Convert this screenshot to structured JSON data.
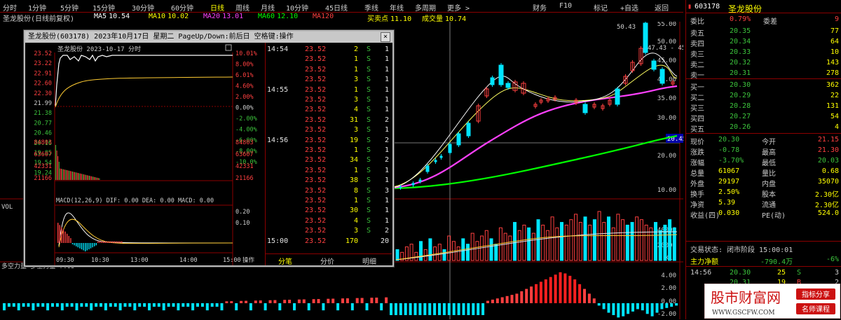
{
  "topbar": {
    "items": [
      "分时",
      "1分钟",
      "5分钟",
      "15分钟",
      "30分钟",
      "60分钟",
      "日线",
      "周线",
      "月线",
      "10分钟",
      "45日线",
      "季线",
      "年线",
      "多周期",
      "更多 >"
    ],
    "right_items": [
      "财务",
      "F10",
      "标记",
      "+自选",
      "返回"
    ]
  },
  "ma_row": {
    "stock_label": "圣龙股份(日线前复权)",
    "ma_items": [
      {
        "label": "MA5",
        "value": "10.54",
        "color": "#ffffff"
      },
      {
        "label": "MA10",
        "value": "10.02",
        "color": "#ffff00"
      },
      {
        "label": "MA20",
        "value": "13.01",
        "color": "#ff40ff"
      },
      {
        "label": "MA60",
        "value": "12.10",
        "color": "#00ff00"
      },
      {
        "label": "MA120",
        "value": "",
        "color": "#ff4040"
      },
      {
        "label": "买卖点",
        "value": "11.10",
        "color": "#ffff00"
      },
      {
        "label": "成交量",
        "value": "10.74",
        "color": "#ffff00"
      }
    ]
  },
  "main_chart": {
    "price_ticks": [
      "55.00",
      "50.00",
      "45.00",
      "40.00",
      "35.00",
      "30.00",
      "20.00",
      "10.00"
    ],
    "highlight_price": "20.45",
    "high_label": "50.43",
    "range_label": "47.43 - 45",
    "volume_label": "VOL",
    "vol_ticks": [
      "40000",
      "20000",
      "X10"
    ],
    "macd_label": "多空力量 多空力量 7.05",
    "macd_ticks": [
      "4.00",
      "2.00",
      "0.00",
      "-2.00"
    ],
    "volume_values": [
      4,
      3,
      5,
      6,
      3,
      7,
      4,
      8,
      5,
      6,
      4,
      9,
      7,
      5,
      8,
      6,
      10,
      7,
      9,
      11,
      8,
      6,
      12,
      10,
      9,
      14,
      11,
      13,
      12,
      10,
      15,
      13,
      11,
      16,
      12,
      14,
      13,
      15,
      17,
      14,
      16,
      13,
      15,
      18,
      14,
      16,
      12,
      17,
      15,
      13,
      14,
      16,
      15,
      13,
      12,
      14,
      11,
      13,
      15,
      12
    ],
    "oscillator_values": [
      -1,
      -1,
      -1,
      -1,
      -1,
      -1,
      -1,
      -1,
      -1,
      -1,
      -1,
      -1,
      -1,
      -1,
      -1,
      -1,
      -1,
      -1,
      -1,
      -1,
      0.2,
      0.3,
      0.4,
      0.5,
      0.6,
      0.7,
      0.8,
      1.0,
      1.2,
      1.4,
      1.6,
      1.8,
      2.0,
      2.2,
      2.4,
      2.6,
      2.5,
      2.3,
      2.0,
      1.6,
      1.2,
      0.8,
      0.4,
      -0.2,
      -0.5,
      -0.8,
      -1.0,
      -1.2,
      -1.1,
      -0.9,
      -0.7,
      -0.5,
      -0.6,
      -0.9,
      -1.1,
      -0.8,
      -0.5,
      -0.4,
      -0.3,
      -0.2
    ]
  },
  "right_panel": {
    "code": "603178",
    "name": "圣龙股份",
    "ratio": {
      "label": "委比",
      "value": "0.79%",
      "label2": "委差",
      "value2": "9"
    },
    "asks": [
      {
        "label": "卖五",
        "price": "20.35",
        "vol": "77"
      },
      {
        "label": "卖四",
        "price": "20.34",
        "vol": "64"
      },
      {
        "label": "卖三",
        "price": "20.33",
        "vol": "10"
      },
      {
        "label": "卖二",
        "price": "20.32",
        "vol": "143"
      },
      {
        "label": "卖一",
        "price": "20.31",
        "vol": "278"
      }
    ],
    "bids": [
      {
        "label": "买一",
        "price": "20.30",
        "vol": "362"
      },
      {
        "label": "买二",
        "price": "20.29",
        "vol": "22"
      },
      {
        "label": "买三",
        "price": "20.28",
        "vol": "131"
      },
      {
        "label": "买四",
        "price": "20.27",
        "vol": "54"
      },
      {
        "label": "买五",
        "price": "20.26",
        "vol": "4"
      }
    ],
    "quote": [
      {
        "l1": "现价",
        "v1": "20.30",
        "l2": "今开",
        "v2": "21.15"
      },
      {
        "l1": "涨跌",
        "v1": "-0.78",
        "l2": "最高",
        "v2": "21.30"
      },
      {
        "l1": "涨幅",
        "v1": "-3.70%",
        "l2": "最低",
        "v2": "20.03"
      },
      {
        "l1": "总量",
        "v1": "61067",
        "l2": "量比",
        "v2": "0.68"
      },
      {
        "l1": "外盘",
        "v1": "29197",
        "l2": "内盘",
        "v2": "35070"
      },
      {
        "l1": "换手",
        "v1": "2.50%",
        "l2": "股本",
        "v2": "2.30亿"
      },
      {
        "l1": "净资",
        "v1": "5.39",
        "l2": "流通",
        "v2": "2.30亿"
      },
      {
        "l1": "收益(四)",
        "v1": "0.030",
        "l2": "PE(动)",
        "v2": "524.0"
      }
    ],
    "status": "交易状态: 闭市阶段 15:00:01",
    "main_force_label": "主力净额",
    "main_force_value": "-790.4万",
    "main_force_pct": "-6%",
    "ticks": [
      {
        "time": "14:56",
        "price": "20.30",
        "vol": "25",
        "bs": "S",
        "n": "3"
      },
      {
        "time": "",
        "price": "20.31",
        "vol": "19",
        "bs": "B",
        "n": "2"
      },
      {
        "time": "",
        "price": "20.31",
        "vol": "16",
        "bs": "B",
        "n": "5"
      }
    ]
  },
  "popup": {
    "title": "圣龙股份(603178) 2023年10月17日 星期二 PageUp/Down:前后日 空格键:操作",
    "mini_title": "圣龙股份 2023-10-17 分时",
    "price_ticks": [
      "23.52",
      "23.22",
      "22.91",
      "22.60",
      "22.30",
      "21.99",
      "21.38",
      "20.77",
      "20.46",
      "20.16",
      "19.85",
      "19.54",
      "19.24"
    ],
    "pct_ticks": [
      "10.01%",
      "8.00%",
      "6.01%",
      "4.60%",
      "2.00%",
      "0.00%",
      "-2.00%",
      "-4.00%",
      "-6.00%",
      "-8.00%",
      "-10.0%"
    ],
    "vol_ticks": [
      "84803",
      "63607",
      "42331",
      "21166"
    ],
    "macd_label": "MACD(12,26,9) DIF: 0.00 DEA: 0.00 MACD: 0.00",
    "macd_ticks": [
      "0.20",
      "0.10"
    ],
    "time_ticks": [
      "09:30",
      "10:30",
      "13:00",
      "14:00",
      "15:00",
      "操作"
    ],
    "ticks": [
      {
        "time": "14:54",
        "price": "23.52",
        "vol": "2",
        "bs": "S",
        "n": "1"
      },
      {
        "time": "",
        "price": "23.52",
        "vol": "1",
        "bs": "S",
        "n": "1"
      },
      {
        "time": "",
        "price": "23.52",
        "vol": "1",
        "bs": "S",
        "n": "1"
      },
      {
        "time": "",
        "price": "23.52",
        "vol": "3",
        "bs": "S",
        "n": "1"
      },
      {
        "time": "14:55",
        "price": "23.52",
        "vol": "1",
        "bs": "S",
        "n": "1"
      },
      {
        "time": "",
        "price": "23.52",
        "vol": "3",
        "bs": "S",
        "n": "1"
      },
      {
        "time": "",
        "price": "23.52",
        "vol": "4",
        "bs": "S",
        "n": "1"
      },
      {
        "time": "",
        "price": "23.52",
        "vol": "31",
        "bs": "S",
        "n": "2"
      },
      {
        "time": "",
        "price": "23.52",
        "vol": "3",
        "bs": "S",
        "n": "1"
      },
      {
        "time": "14:56",
        "price": "23.52",
        "vol": "19",
        "bs": "S",
        "n": "2"
      },
      {
        "time": "",
        "price": "23.52",
        "vol": "1",
        "bs": "S",
        "n": "1"
      },
      {
        "time": "",
        "price": "23.52",
        "vol": "34",
        "bs": "S",
        "n": "2"
      },
      {
        "time": "",
        "price": "23.52",
        "vol": "1",
        "bs": "S",
        "n": "1"
      },
      {
        "time": "",
        "price": "23.52",
        "vol": "38",
        "bs": "S",
        "n": "1"
      },
      {
        "time": "",
        "price": "23.52",
        "vol": "8",
        "bs": "S",
        "n": "3"
      },
      {
        "time": "",
        "price": "23.52",
        "vol": "1",
        "bs": "S",
        "n": "1"
      },
      {
        "time": "",
        "price": "23.52",
        "vol": "30",
        "bs": "S",
        "n": "1"
      },
      {
        "time": "",
        "price": "23.52",
        "vol": "4",
        "bs": "S",
        "n": "1"
      },
      {
        "time": "",
        "price": "23.52",
        "vol": "3",
        "bs": "S",
        "n": "2"
      },
      {
        "time": "15:00",
        "price": "23.52",
        "vol": "170",
        "bs": "",
        "n": "20"
      }
    ],
    "tabs": [
      "分笔",
      "分价",
      "明细"
    ]
  },
  "watermark": {
    "title": "股市财富网",
    "url": "WWW.GSCFW.COM",
    "tag1": "指标分享",
    "tag2": "名师课程"
  }
}
